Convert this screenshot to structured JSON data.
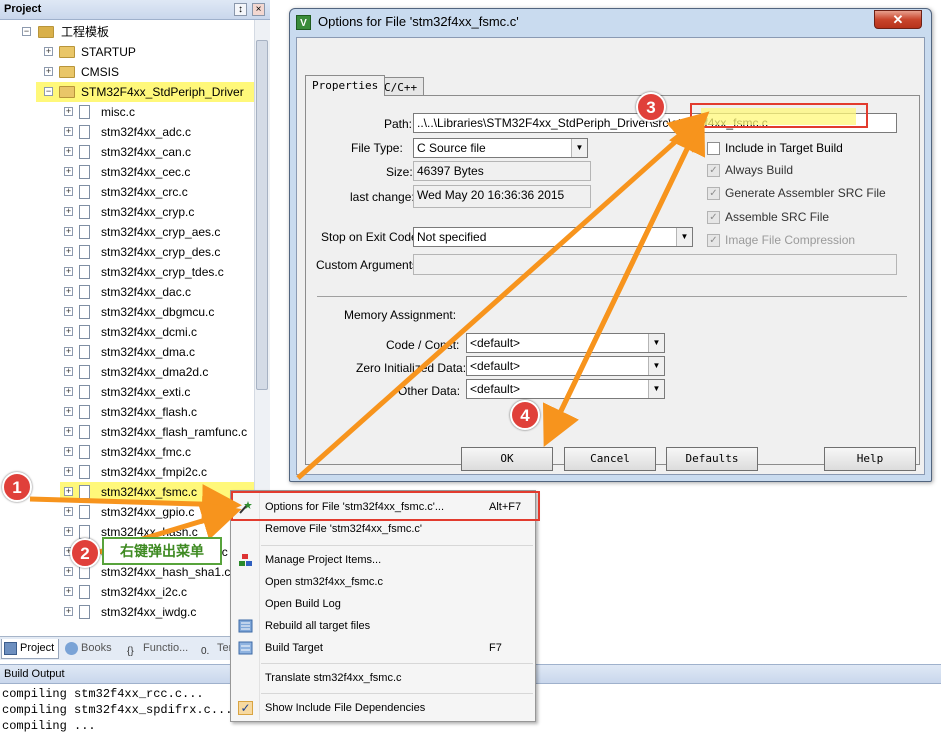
{
  "project_panel": {
    "title": "Project",
    "pin_glyph": "↕",
    "close_glyph": "×",
    "root_label": "工程模板",
    "groups": [
      "STARTUP",
      "CMSIS",
      "STM32F4xx_StdPeriph_Driver"
    ],
    "files": [
      "misc.c",
      "stm32f4xx_adc.c",
      "stm32f4xx_can.c",
      "stm32f4xx_cec.c",
      "stm32f4xx_crc.c",
      "stm32f4xx_cryp.c",
      "stm32f4xx_cryp_aes.c",
      "stm32f4xx_cryp_des.c",
      "stm32f4xx_cryp_tdes.c",
      "stm32f4xx_dac.c",
      "stm32f4xx_dbgmcu.c",
      "stm32f4xx_dcmi.c",
      "stm32f4xx_dma.c",
      "stm32f4xx_dma2d.c",
      "stm32f4xx_exti.c",
      "stm32f4xx_flash.c",
      "stm32f4xx_flash_ramfunc.c",
      "stm32f4xx_fmc.c",
      "stm32f4xx_fmpi2c.c",
      "stm32f4xx_fsmc.c",
      "stm32f4xx_gpio.c",
      "stm32f4xx_hash.c",
      "stm32f4xx_hash_md5.c",
      "stm32f4xx_hash_sha1.c",
      "stm32f4xx_i2c.c",
      "stm32f4xx_iwdg.c"
    ],
    "tabs": [
      "Project",
      "Books",
      "Functio...",
      "Tem..."
    ]
  },
  "build_output": {
    "title": "Build Output",
    "lines": [
      "compiling stm32f4xx_rcc.c...",
      "compiling stm32f4xx_spdifrx.c...",
      "compiling ..."
    ]
  },
  "dialog": {
    "title": "Options for File 'stm32f4xx_fsmc.c'",
    "close_glyph": "✕",
    "tabs": [
      "Properties",
      "C/C++"
    ],
    "path_label": "Path:",
    "path_value": "..\\..\\Libraries\\STM32F4xx_StdPeriph_Driver\\src\\stm32f4xx_fsmc.c",
    "filetype_label": "File Type:",
    "filetype_value": "C Source file",
    "size_label": "Size:",
    "size_value": "46397 Bytes",
    "lastchange_label": "last change:",
    "lastchange_value": "Wed May 20 16:36:36 2015",
    "checkboxes": [
      {
        "label": "Include in Target Build",
        "checked": false,
        "enabled": true
      },
      {
        "label": "Always Build",
        "checked": true,
        "enabled": false
      },
      {
        "label": "Generate Assembler SRC File",
        "checked": true,
        "enabled": false
      },
      {
        "label": "Assemble SRC File",
        "checked": true,
        "enabled": false
      },
      {
        "label": "Image File Compression",
        "checked": true,
        "enabled": false
      }
    ],
    "stop_label": "Stop on Exit Code:",
    "stop_value": "Not specified",
    "custom_label": "Custom Arguments:",
    "memory_label": "Memory Assignment:",
    "code_label": "Code / Const:",
    "code_value": "<default>",
    "zero_label": "Zero Initialized Data:",
    "zero_value": "<default>",
    "other_label": "Other Data:",
    "other_value": "<default>",
    "buttons": {
      "ok": "OK",
      "cancel": "Cancel",
      "defaults": "Defaults",
      "help": "Help"
    }
  },
  "context_menu": {
    "items": [
      {
        "label": "Options for File 'stm32f4xx_fsmc.c'...",
        "shortcut": "Alt+F7",
        "icon": "options-wand-icon"
      },
      {
        "label": "Remove File 'stm32f4xx_fsmc.c'",
        "shortcut": "",
        "icon": ""
      },
      {
        "label": "Manage Project Items...",
        "shortcut": "",
        "icon": "manage-items-icon"
      },
      {
        "label": "Open stm32f4xx_fsmc.c",
        "shortcut": "",
        "icon": ""
      },
      {
        "label": "Open Build Log",
        "shortcut": "",
        "icon": ""
      },
      {
        "label": "Rebuild all target files",
        "shortcut": "",
        "icon": "rebuild-icon"
      },
      {
        "label": "Build Target",
        "shortcut": "F7",
        "icon": "build-icon"
      },
      {
        "label": "Translate stm32f4xx_fsmc.c",
        "shortcut": "",
        "icon": ""
      },
      {
        "label": "Show Include File Dependencies",
        "shortcut": "",
        "icon": "check-icon"
      }
    ]
  },
  "annotations": {
    "badges": [
      "1",
      "2",
      "3",
      "4"
    ],
    "callout": "右键弹出菜单",
    "accent_color": "#f7941d",
    "badge_color": "#e0403a",
    "highlight_color": "#fff87a"
  }
}
